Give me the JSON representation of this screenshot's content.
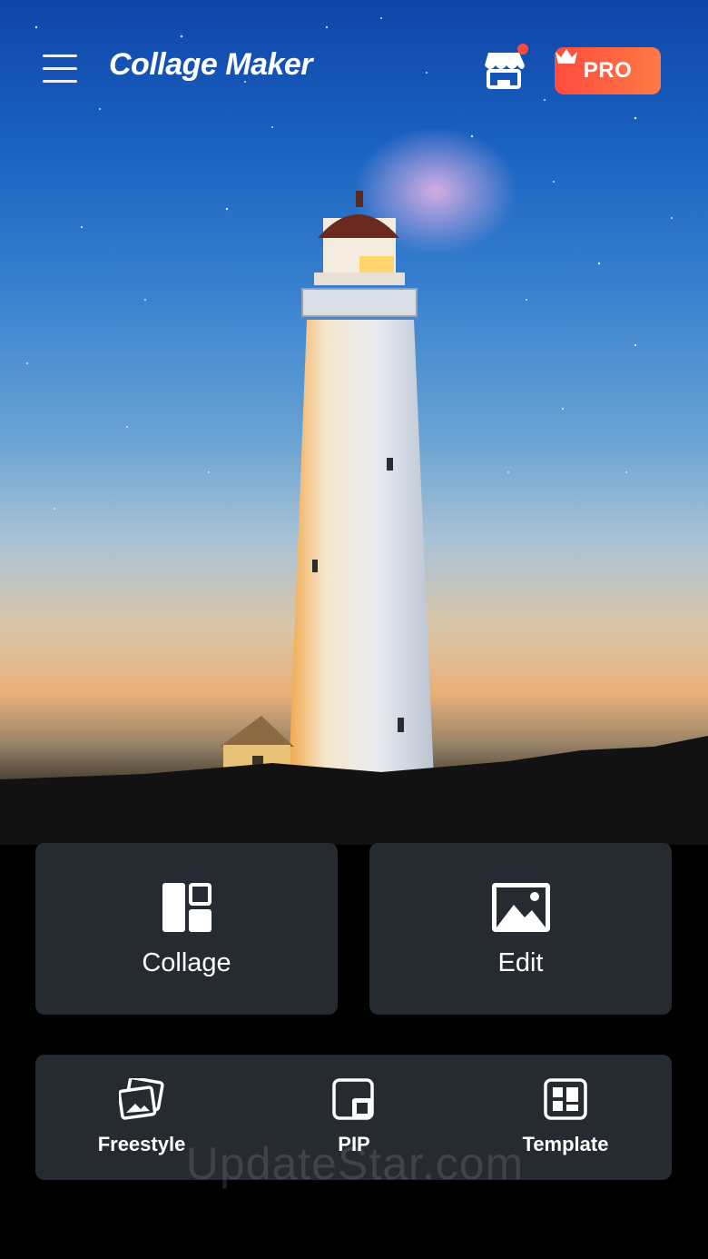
{
  "header": {
    "app_title": "Collage Maker",
    "menu_icon": "hamburger-menu-icon",
    "store_icon": "store-icon",
    "pro_label": "PRO",
    "pro_icon": "crown-icon",
    "accent_color": "#ff5a3f"
  },
  "actions": {
    "collage": {
      "label": "Collage",
      "icon": "collage-layout-icon"
    },
    "edit": {
      "label": "Edit",
      "icon": "image-icon"
    }
  },
  "tools": [
    {
      "label": "Freestyle",
      "icon": "freestyle-photos-icon"
    },
    {
      "label": "PIP",
      "icon": "pip-icon"
    },
    {
      "label": "Template",
      "icon": "template-grid-icon"
    }
  ],
  "watermark": "UpdateStar.com",
  "colors": {
    "card_bg": "#262a31",
    "background": "#000000"
  }
}
